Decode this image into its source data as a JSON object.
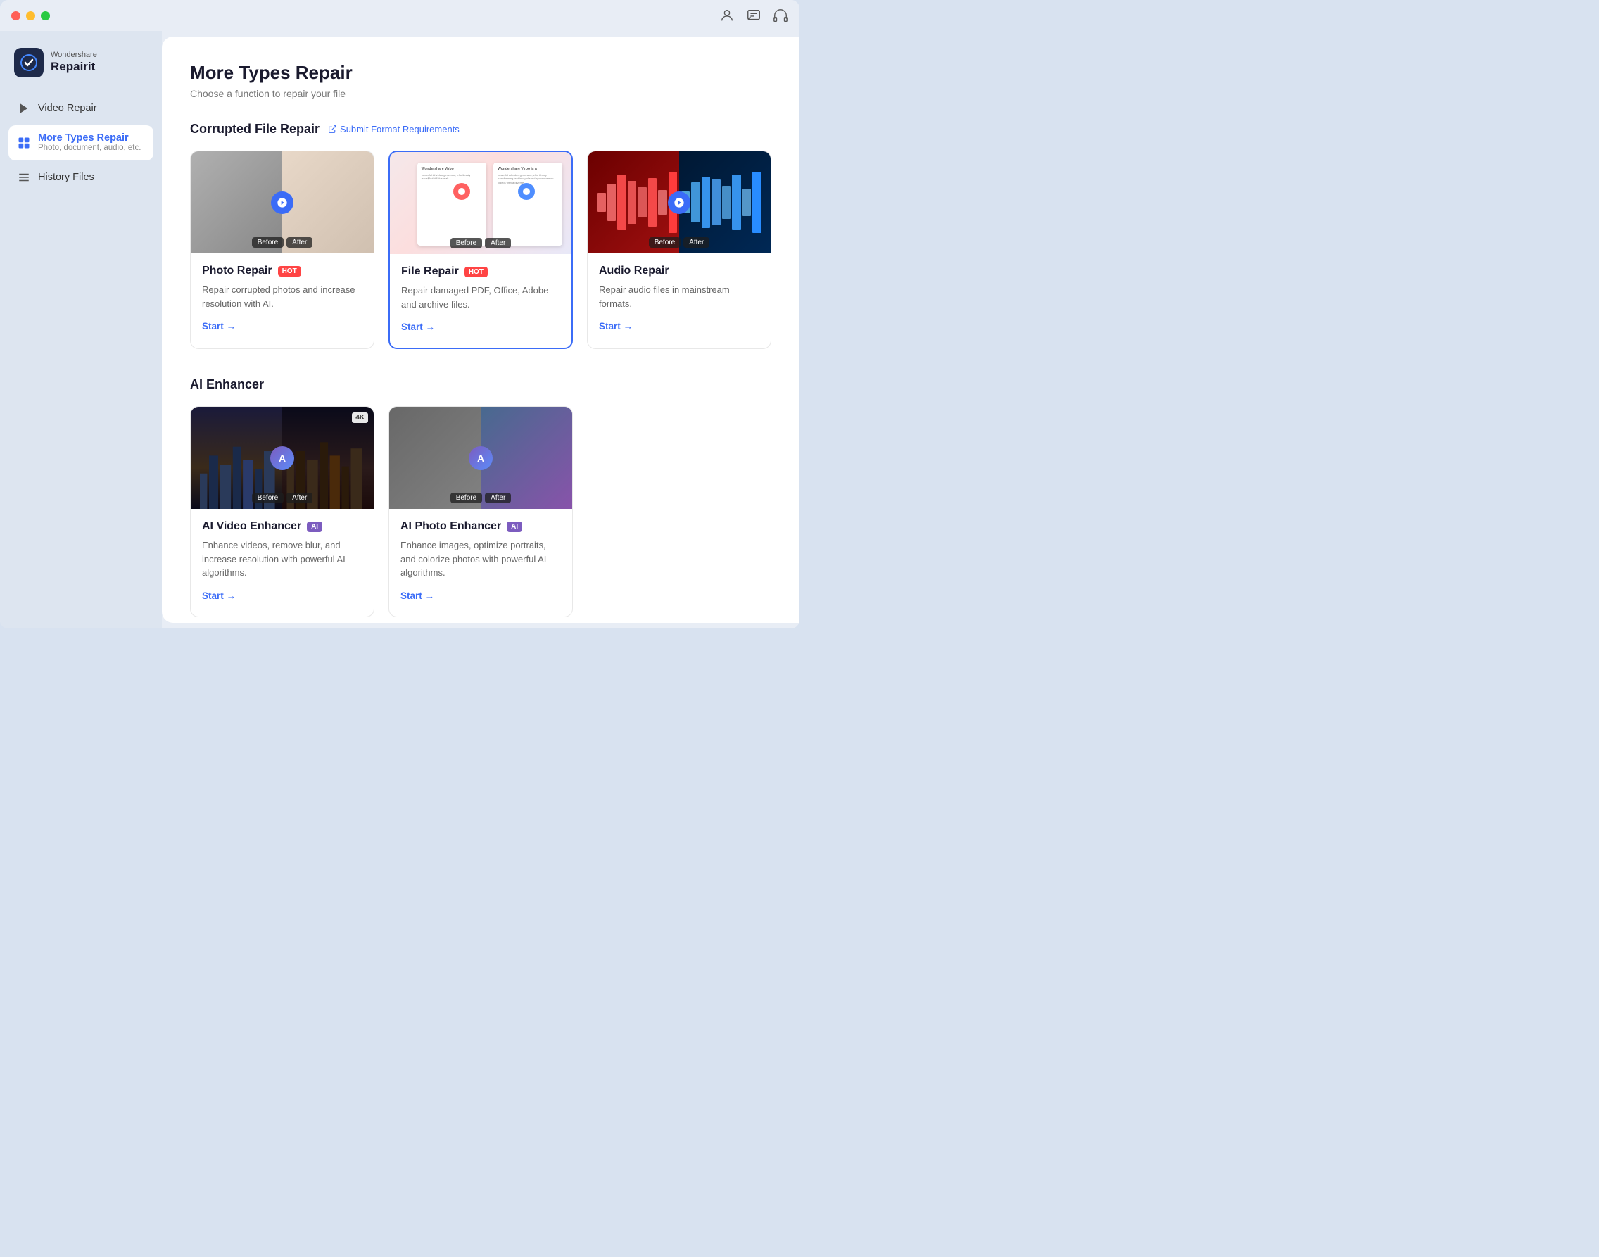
{
  "window": {
    "title": "Wondershare Repairit"
  },
  "titlebar": {
    "icons": [
      "user-icon",
      "chat-icon",
      "headphone-icon"
    ]
  },
  "logo": {
    "brand": "Wondershare",
    "product": "Repairit"
  },
  "sidebar": {
    "items": [
      {
        "id": "video-repair",
        "label": "Video Repair",
        "active": false
      },
      {
        "id": "more-types-repair",
        "label": "More Types Repair",
        "sublabel": "Photo, document, audio, etc.",
        "active": true
      },
      {
        "id": "history-files",
        "label": "History Files",
        "active": false
      }
    ]
  },
  "main": {
    "page_title": "More Types Repair",
    "page_subtitle": "Choose a function to repair your file",
    "sections": [
      {
        "id": "corrupted-file-repair",
        "title": "Corrupted File Repair",
        "link_label": "Submit Format Requirements",
        "cards": [
          {
            "id": "photo-repair",
            "title": "Photo Repair",
            "badge": "HOT",
            "badge_type": "hot",
            "description": "Repair corrupted photos and increase resolution with AI.",
            "start_label": "Start →"
          },
          {
            "id": "file-repair",
            "title": "File Repair",
            "badge": "HOT",
            "badge_type": "hot",
            "description": "Repair damaged PDF, Office, Adobe and archive files.",
            "start_label": "Start →",
            "selected": true
          },
          {
            "id": "audio-repair",
            "title": "Audio Repair",
            "badge": null,
            "description": "Repair audio files in mainstream formats.",
            "start_label": "Start →"
          }
        ]
      },
      {
        "id": "ai-enhancer",
        "title": "AI Enhancer",
        "cards": [
          {
            "id": "ai-video-enhancer",
            "title": "AI Video Enhancer",
            "badge": "AI",
            "badge_type": "ai",
            "description": "Enhance videos, remove blur, and increase resolution with powerful AI algorithms.",
            "start_label": "Start →"
          },
          {
            "id": "ai-photo-enhancer",
            "title": "AI Photo Enhancer",
            "badge": "AI",
            "badge_type": "ai",
            "description": "Enhance images, optimize portraits, and colorize photos with powerful AI algorithms.",
            "start_label": "Start →"
          }
        ]
      }
    ]
  }
}
